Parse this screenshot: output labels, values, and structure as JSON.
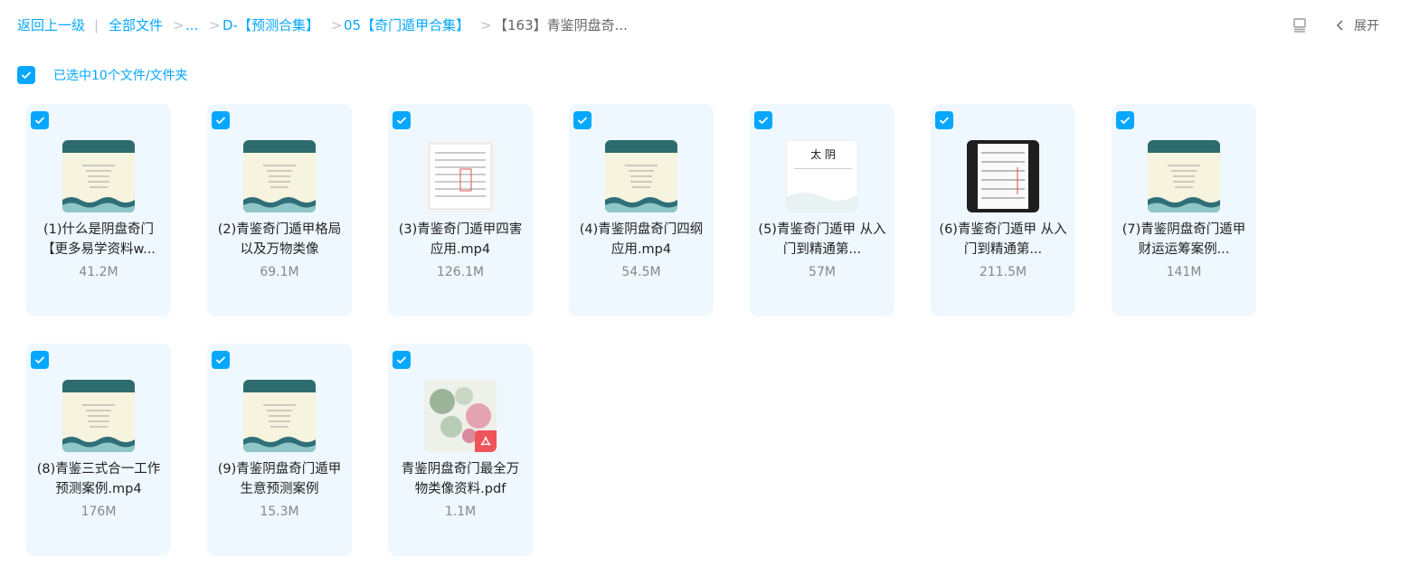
{
  "breadcrumb": {
    "back": "返回上一级",
    "all_files": "全部文件",
    "ellipsis": "...",
    "level1": "D-【预测合集】",
    "level2": "05【奇门遁甲合集】",
    "current": "【163】青鉴阴盘奇...",
    "separator": ">",
    "divider": "|"
  },
  "toolbar": {
    "expand_label": "展开",
    "layout_icon": "list-layout-icon",
    "collapse_icon": "chevron-left-icon"
  },
  "selection": {
    "label": "已选中10个文件/文件夹"
  },
  "colors": {
    "accent": "#06a7ff",
    "card_bg": "#eef8fe",
    "thumb_band": "#2e6b6f",
    "pdf_badge": "#f0545b"
  },
  "files": [
    {
      "name": "(1)什么是阴盘奇门【更多易学资料w...",
      "size": "41.2M",
      "thumb": "video-cover"
    },
    {
      "name": "(2)青鉴奇门遁甲格局以及万物类像",
      "size": "69.1M",
      "thumb": "video-cover"
    },
    {
      "name": "(3)青鉴奇门遁甲四害应用.mp4",
      "size": "126.1M",
      "thumb": "doc-white"
    },
    {
      "name": "(4)青鉴阴盘奇门四纲应用.mp4",
      "size": "54.5M",
      "thumb": "video-cover"
    },
    {
      "name": "(5)青鉴奇门遁甲 从入门到精通第...",
      "size": "57M",
      "thumb": "taiyin",
      "thumb_text": "太 阴"
    },
    {
      "name": "(6)青鉴奇门遁甲 从入门到精通第...",
      "size": "211.5M",
      "thumb": "doc-dark"
    },
    {
      "name": "(7)青鉴阴盘奇门遁甲 财运运筹案例...",
      "size": "141M",
      "thumb": "video-cover"
    },
    {
      "name": "(8)青鉴三式合一工作预测案例.mp4",
      "size": "176M",
      "thumb": "video-cover"
    },
    {
      "name": "(9)青鉴阴盘奇门遁甲生意预测案例",
      "size": "15.3M",
      "thumb": "video-cover"
    },
    {
      "name": "青鉴阴盘奇门最全万物类像资料.pdf",
      "size": "1.1M",
      "thumb": "pdf"
    }
  ]
}
